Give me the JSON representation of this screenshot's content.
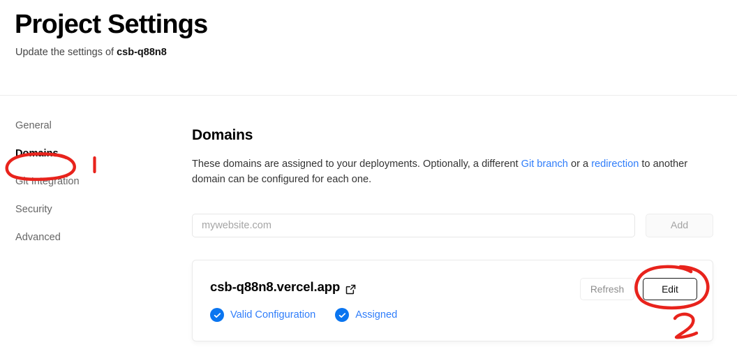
{
  "header": {
    "title": "Project Settings",
    "subtitle_prefix": "Update the settings of ",
    "project_name": "csb-q88n8"
  },
  "sidebar": {
    "items": [
      {
        "label": "General",
        "active": false
      },
      {
        "label": "Domains",
        "active": true
      },
      {
        "label": "Git Integration",
        "active": false
      },
      {
        "label": "Security",
        "active": false
      },
      {
        "label": "Advanced",
        "active": false
      }
    ]
  },
  "main": {
    "section_title": "Domains",
    "description": {
      "part1": "These domains are assigned to your deployments. Optionally, a different ",
      "link1": "Git branch",
      "part2": " or a ",
      "link2": "redirection",
      "part3": " to another domain can be configured for each one."
    },
    "add_form": {
      "input_value": "",
      "input_placeholder": "mywebsite.com",
      "add_label": "Add"
    },
    "domain_card": {
      "domain": "csb-q88n8.vercel.app",
      "external_link_icon": "external-link-icon",
      "statuses": [
        {
          "label": "Valid Configuration",
          "icon": "check-circle-icon"
        },
        {
          "label": "Assigned",
          "icon": "check-circle-icon"
        }
      ],
      "refresh_label": "Refresh",
      "edit_label": "Edit"
    }
  },
  "annotations": {
    "color": "#E8231C",
    "marks": [
      {
        "name": "step-1-number",
        "text": "1"
      },
      {
        "name": "step-2-number",
        "text": "2"
      },
      {
        "name": "circle-domains",
        "text": ""
      },
      {
        "name": "circle-edit",
        "text": ""
      }
    ]
  },
  "colors": {
    "link_blue": "#2f7dfa",
    "status_blue": "#0a75f0",
    "annotation_red": "#E8231C",
    "border": "#eaeaea"
  }
}
